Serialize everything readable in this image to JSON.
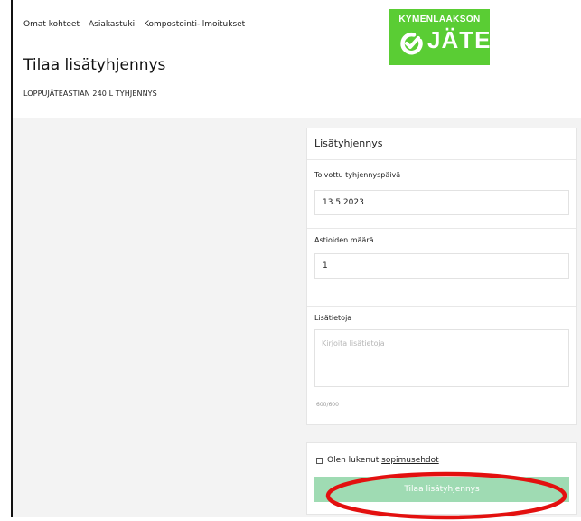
{
  "nav": {
    "items": [
      {
        "label": "Omat kohteet"
      },
      {
        "label": "Asiakastuki"
      },
      {
        "label": "Kompostointi-ilmoitukset"
      }
    ]
  },
  "logo": {
    "line1": "KYMENLAAKSON",
    "line2": "JÄTE",
    "mark_icon": "power-check-icon",
    "color": "#5acd34"
  },
  "page": {
    "title": "Tilaa lisätyhjennys",
    "subtitle": "LOPPUJÄTEASTIAN 240 L TYHJENNYS"
  },
  "form": {
    "card_title": "Lisätyhjennys",
    "date": {
      "label": "Toivottu tyhjennyspäivä",
      "value": "13.5.2023"
    },
    "quantity": {
      "label": "Astioiden määrä",
      "value": "1"
    },
    "notes": {
      "label": "Lisätietoja",
      "placeholder": "Kirjoita lisätietoja",
      "counter": "600/600"
    }
  },
  "submit": {
    "terms_prefix": "Olen lukenut ",
    "terms_link": "sopimusehdot",
    "button_label": "Tilaa lisätyhjennys",
    "button_color": "#9fdbb3"
  },
  "annotation": {
    "color": "#e3100f"
  }
}
